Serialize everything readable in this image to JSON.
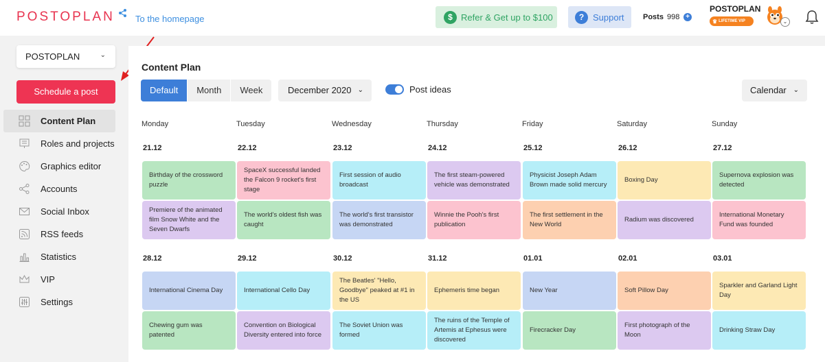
{
  "header": {
    "logo": "POSTOPLAN",
    "homepage_link": "To the homepage",
    "refer_label": "Refer & Get up to $100",
    "support_label": "Support",
    "posts_label": "Posts",
    "posts_count": "998",
    "account_name": "POSTOPLAN",
    "vip_badge": "LIFETIME VIP"
  },
  "sidebar": {
    "workspace": "POSTOPLAN",
    "schedule_label": "Schedule a post",
    "items": [
      {
        "label": "Content Plan",
        "icon": "content-plan-icon",
        "active": true
      },
      {
        "label": "Roles and projects",
        "icon": "roles-icon",
        "active": false
      },
      {
        "label": "Graphics editor",
        "icon": "palette-icon",
        "active": false
      },
      {
        "label": "Accounts",
        "icon": "share-icon",
        "active": false
      },
      {
        "label": "Social Inbox",
        "icon": "mail-icon",
        "active": false
      },
      {
        "label": "RSS feeds",
        "icon": "rss-icon",
        "active": false
      },
      {
        "label": "Statistics",
        "icon": "chart-icon",
        "active": false
      },
      {
        "label": "VIP",
        "icon": "crown-icon",
        "active": false
      },
      {
        "label": "Settings",
        "icon": "sliders-icon",
        "active": false
      }
    ]
  },
  "main": {
    "title": "Content Plan",
    "views": [
      {
        "label": "Default",
        "active": true
      },
      {
        "label": "Month",
        "active": false
      },
      {
        "label": "Week",
        "active": false
      }
    ],
    "month": "December 2020",
    "post_ideas_label": "Post ideas",
    "calendar_select": "Calendar",
    "days": [
      "Monday",
      "Tuesday",
      "Wednesday",
      "Thursday",
      "Friday",
      "Saturday",
      "Sunday"
    ],
    "weeks": [
      {
        "dates": [
          "21.12",
          "22.12",
          "23.12",
          "24.12",
          "25.12",
          "26.12",
          "27.12"
        ],
        "rows": [
          [
            {
              "text": "Birthday of the crossword puzzle",
              "color": "#b8e6c1"
            },
            {
              "text": "SpaceX successful landed the Falcon 9 rocket's first stage",
              "color": "#fcc3cf"
            },
            {
              "text": "First session of audio broadcast",
              "color": "#b6eef8"
            },
            {
              "text": "The first steam-powered vehicle was demonstrated",
              "color": "#dcc9f0"
            },
            {
              "text": "Physicist Joseph Adam Brown made solid mercury",
              "color": "#b6eef8"
            },
            {
              "text": "Boxing Day",
              "color": "#fde9b4"
            },
            {
              "text": "Supernova explosion was detected",
              "color": "#b8e6c1"
            }
          ],
          [
            {
              "text": "Premiere of the animated film Snow White and the Seven Dwarfs",
              "color": "#dcc9f0"
            },
            {
              "text": "The world's oldest fish was caught",
              "color": "#b8e6c1"
            },
            {
              "text": "The world's first transistor was demonstrated",
              "color": "#c6d6f4"
            },
            {
              "text": "Winnie the Pooh's first publication",
              "color": "#fcc3cf"
            },
            {
              "text": "The first settlement in the New World",
              "color": "#fdd0b0"
            },
            {
              "text": "Radium was discovered",
              "color": "#dcc9f0"
            },
            {
              "text": "International Monetary Fund was founded",
              "color": "#fcc3cf"
            }
          ]
        ]
      },
      {
        "dates": [
          "28.12",
          "29.12",
          "30.12",
          "31.12",
          "01.01",
          "02.01",
          "03.01"
        ],
        "rows": [
          [
            {
              "text": "International Cinema Day",
              "color": "#c6d6f4"
            },
            {
              "text": "International Cello Day",
              "color": "#b6eef8"
            },
            {
              "text": "The Beatles' \"Hello, Goodbye\" peaked at #1 in the US",
              "color": "#fde9b4"
            },
            {
              "text": "Ephemeris time began",
              "color": "#fde9b4"
            },
            {
              "text": "New Year",
              "color": "#c6d6f4"
            },
            {
              "text": "Soft Pillow Day",
              "color": "#fdd0b0"
            },
            {
              "text": "Sparkler and Garland Light Day",
              "color": "#fde9b4"
            }
          ],
          [
            {
              "text": "Chewing gum was patented",
              "color": "#b8e6c1"
            },
            {
              "text": "Convention on Biological Diversity entered into force",
              "color": "#dcc9f0"
            },
            {
              "text": "The Soviet Union was formed",
              "color": "#b6eef8"
            },
            {
              "text": "The ruins of the Temple of Artemis at Ephesus were discovered",
              "color": "#b6eef8"
            },
            {
              "text": "Firecracker Day",
              "color": "#b8e6c1"
            },
            {
              "text": "First photograph of the Moon",
              "color": "#dcc9f0"
            },
            {
              "text": "Drinking Straw Day",
              "color": "#b6eef8"
            }
          ]
        ]
      }
    ]
  }
}
